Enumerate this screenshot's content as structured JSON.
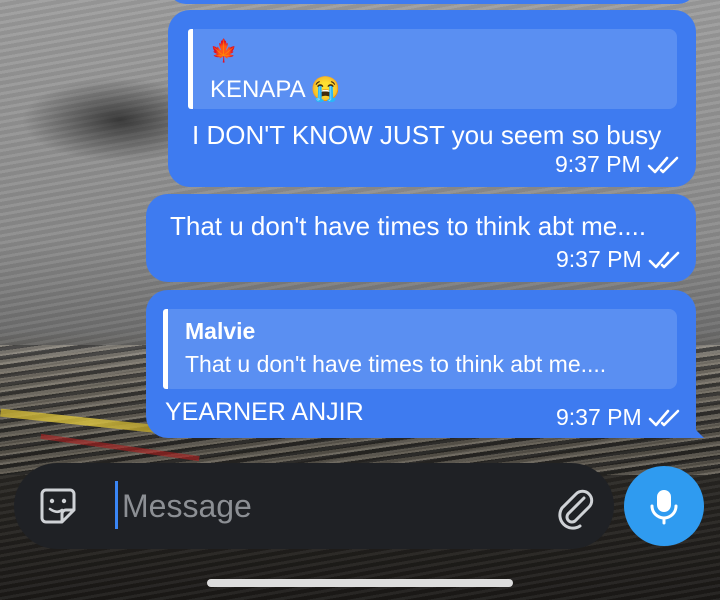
{
  "messages": [
    {
      "quote_label": "KENAPA 😭",
      "text": "I DON'T KNOW JUST you seem so busy",
      "time": "9:37 PM"
    },
    {
      "text": "That u don't have times to think abt me....",
      "time": "9:37 PM"
    },
    {
      "quote_author": "Malvie",
      "quote_text": "That u don't have times to think abt me....",
      "text": "YEARNER ANJIR",
      "time": "9:37 PM"
    }
  ],
  "composer": {
    "placeholder": "Message"
  },
  "icons": {
    "sticker": "sticker-icon",
    "attach": "paperclip-icon",
    "mic": "microphone-icon",
    "read": "double-check-icon",
    "quote_emoji": "maple-leaf-icon"
  },
  "colors": {
    "bubble": "#3e7bf0",
    "quote": "#5a8ff2",
    "mic_button": "#2f9bf0",
    "input_bg": "#1f2125"
  }
}
